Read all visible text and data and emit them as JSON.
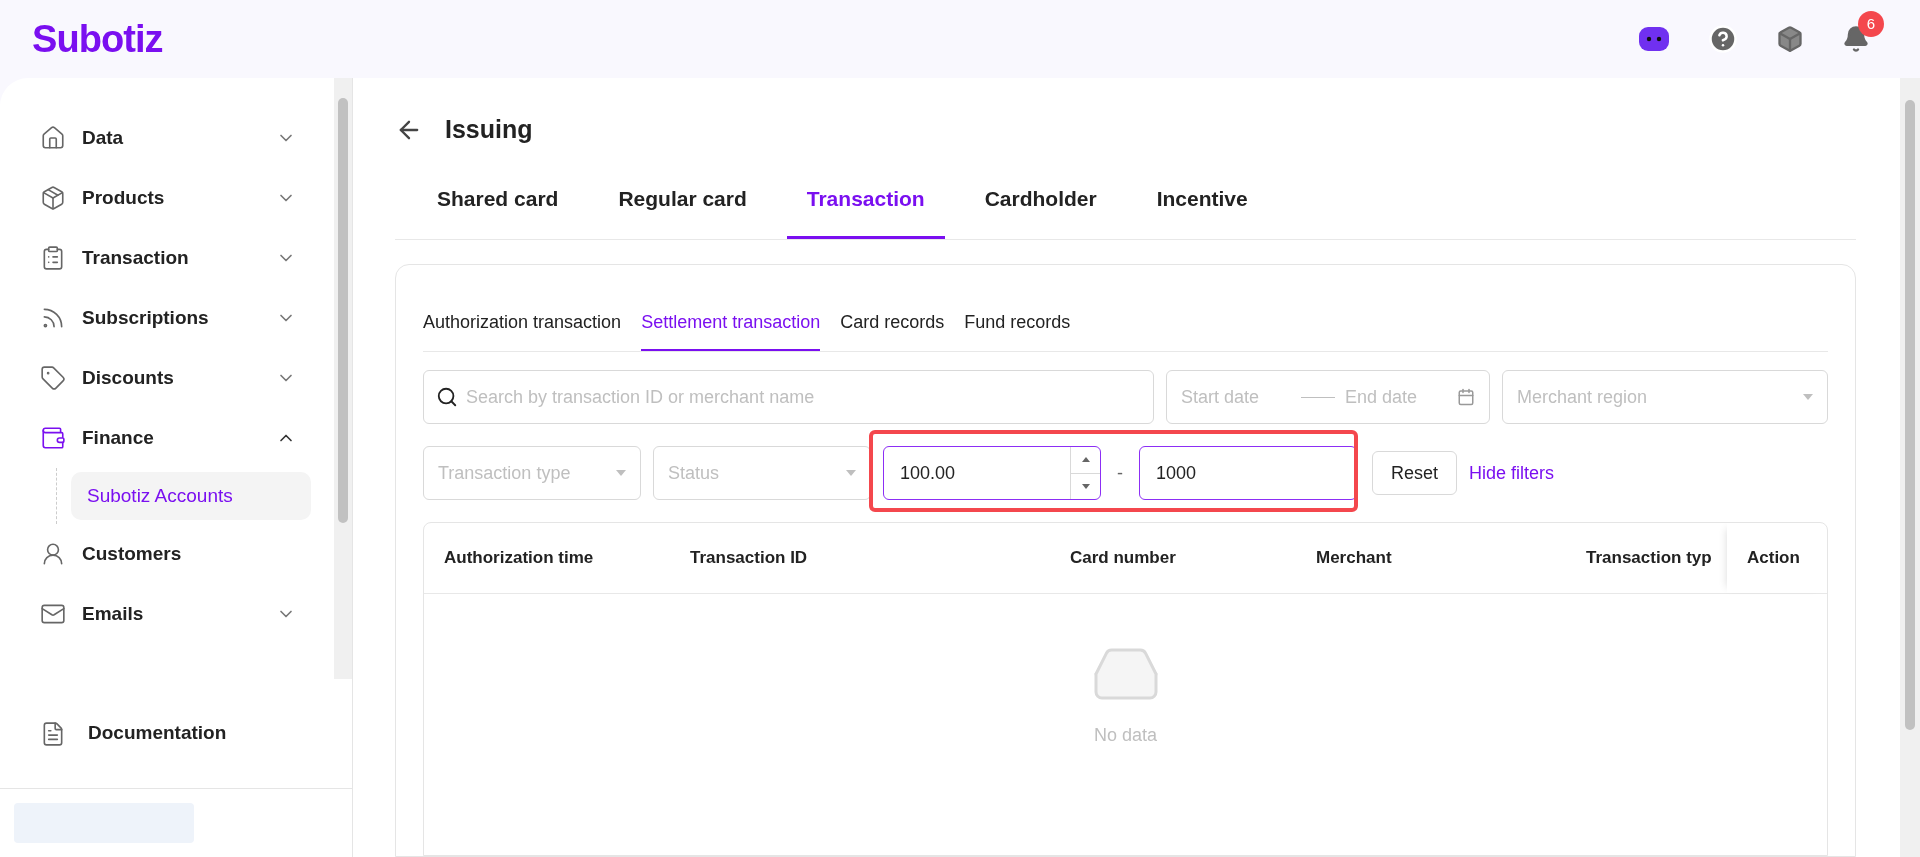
{
  "header": {
    "logo": "Subotiz",
    "notifications": "6"
  },
  "sidebar": {
    "items": [
      {
        "label": "Data",
        "expanded": false
      },
      {
        "label": "Products",
        "expanded": false
      },
      {
        "label": "Transaction",
        "expanded": false
      },
      {
        "label": "Subscriptions",
        "expanded": false
      },
      {
        "label": "Discounts",
        "expanded": false
      },
      {
        "label": "Finance",
        "expanded": true,
        "selected": true,
        "children": [
          {
            "label": "Subotiz Accounts",
            "selected": true
          }
        ]
      },
      {
        "label": "Customers"
      },
      {
        "label": "Emails",
        "expanded": false
      }
    ],
    "footer": "Documentation"
  },
  "page": {
    "title": "Issuing",
    "tabs": [
      {
        "label": "Shared card",
        "selected": false
      },
      {
        "label": "Regular card",
        "selected": false
      },
      {
        "label": "Transaction",
        "selected": true
      },
      {
        "label": "Cardholder",
        "selected": false
      },
      {
        "label": "Incentive",
        "selected": false
      }
    ],
    "subtabs": [
      {
        "label": "Authorization transaction",
        "selected": false
      },
      {
        "label": "Settlement transaction",
        "selected": true
      },
      {
        "label": "Card records",
        "selected": false
      },
      {
        "label": "Fund records",
        "selected": false
      }
    ],
    "filters": {
      "search": {
        "placeholder": "Search by transaction ID or merchant name"
      },
      "start_date": {
        "placeholder": "Start date"
      },
      "end_date": {
        "placeholder": "End date"
      },
      "merchant_region": {
        "placeholder": "Merchant region"
      },
      "transaction_type": {
        "placeholder": "Transaction type"
      },
      "status": {
        "placeholder": "Status"
      },
      "amount_min": {
        "value": "100.00"
      },
      "separator": "-",
      "amount_max": {
        "value": "1000"
      },
      "reset": "Reset",
      "hide_filters": "Hide filters"
    },
    "table": {
      "columns": [
        "Authorization time",
        "Transaction ID",
        "Card number",
        "Merchant",
        "Transaction typ",
        "Action"
      ],
      "empty": "No data"
    }
  }
}
